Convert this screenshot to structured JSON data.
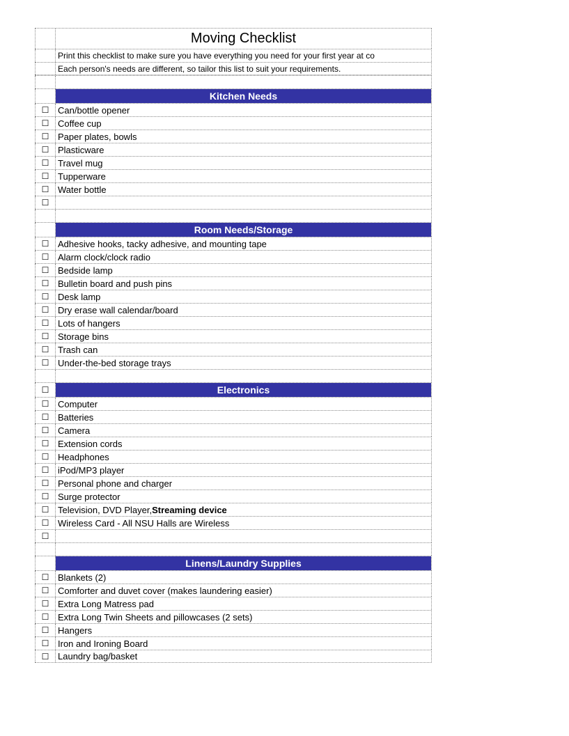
{
  "title": "Moving Checklist",
  "description": [
    "Print this checklist to make sure you have everything you need for your first year at co",
    "Each person's needs are different, so tailor this list to suit your requirements."
  ],
  "sections": [
    {
      "heading": "Kitchen Needs",
      "hasLeadingCheckboxOnHeader": false,
      "items": [
        "Can/bottle opener",
        "Coffee cup",
        "Paper plates, bowls",
        "Plasticware",
        "Travel mug",
        "Tupperware",
        "Water bottle"
      ],
      "trailingBlankCheckbox": true
    },
    {
      "heading": "Room Needs/Storage",
      "hasLeadingCheckboxOnHeader": false,
      "items": [
        "Adhesive hooks, tacky adhesive, and mounting tape",
        "Alarm clock/clock radio",
        "Bedside lamp",
        "Bulletin board and push pins",
        "Desk lamp",
        "Dry erase wall calendar/board",
        "Lots of hangers",
        "Storage bins",
        "Trash can",
        "Under-the-bed storage trays"
      ],
      "trailingBlankCheckbox": false
    },
    {
      "heading": "Electronics",
      "hasLeadingCheckboxOnHeader": true,
      "items": [
        "Computer",
        "Batteries",
        "Camera",
        "Extension cords",
        "Headphones",
        "iPod/MP3 player",
        "Personal phone and charger",
        "Surge protector",
        "Television, DVD Player, Streaming device",
        "Wireless Card - All NSU Halls are Wireless"
      ],
      "trailingBlankCheckbox": true
    },
    {
      "heading": "Linens/Laundry Supplies",
      "hasLeadingCheckboxOnHeader": false,
      "items": [
        "Blankets (2)",
        "Comforter and duvet cover (makes laundering easier)",
        "Extra Long Matress pad",
        "Extra Long Twin Sheets and pillowcases (2 sets)",
        "Hangers",
        "Iron and Ironing Board",
        "Laundry bag/basket"
      ],
      "trailingBlankCheckbox": false
    }
  ],
  "checkboxGlyph": "☐",
  "boldKeyword": "Streaming device"
}
